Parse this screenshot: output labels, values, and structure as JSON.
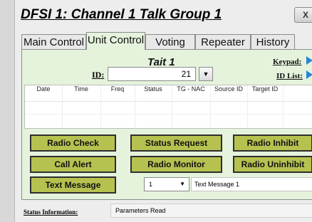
{
  "window": {
    "title": "DFSI 1: Channel 1 Talk Group 1",
    "close_label": "X"
  },
  "tabs": [
    "Main Control",
    "Unit Control",
    "Voting",
    "Repeater",
    "History"
  ],
  "active_tab": "Unit Control",
  "unit": {
    "radio_name": "Tait 1",
    "id_label": "ID:",
    "id_value": "21",
    "keypad_label": "Keypad:",
    "id_list_label": "ID List:"
  },
  "table": {
    "columns": [
      "Date",
      "Time",
      "Freq",
      "Status",
      "TG - NAC",
      "Source ID",
      "Target ID"
    ],
    "rows": []
  },
  "buttons": {
    "radio_check": "Radio Check",
    "status_request": "Status Request",
    "radio_inhibit": "Radio Inhibit",
    "call_alert": "Call Alert",
    "radio_monitor": "Radio Monitor",
    "radio_uninhibit": "Radio Uninhibit",
    "text_message": "Text Message"
  },
  "text_message": {
    "selected": "1",
    "value": "Text Message 1"
  },
  "status": {
    "label": "Status Information:",
    "value": "Parameters Read"
  },
  "colors": {
    "panel_bg": "#e5f3dc",
    "button_bg": "#b6c24f",
    "arrow": "#2a86d6"
  }
}
